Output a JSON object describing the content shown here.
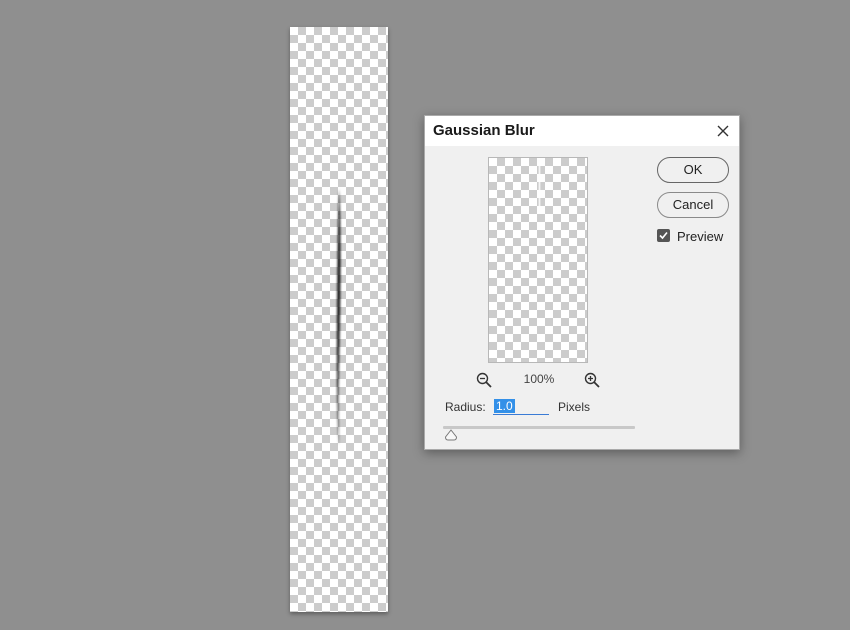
{
  "dialog": {
    "title": "Gaussian Blur",
    "ok_label": "OK",
    "cancel_label": "Cancel",
    "preview_label": "Preview",
    "preview_checked": true,
    "zoom_value": "100%",
    "radius_label": "Radius:",
    "radius_value": "1.0",
    "units_label": "Pixels",
    "slider_fraction": 0.04
  },
  "icons": {
    "close": "close-icon",
    "zoom_out": "zoom-out-icon",
    "zoom_in": "zoom-in-icon",
    "check": "check-icon",
    "slider_thumb": "slider-thumb-icon"
  },
  "colors": {
    "workspace": "#8f8f8f",
    "dialog_bg": "#f0f0f0",
    "selection": "#3390e8"
  }
}
